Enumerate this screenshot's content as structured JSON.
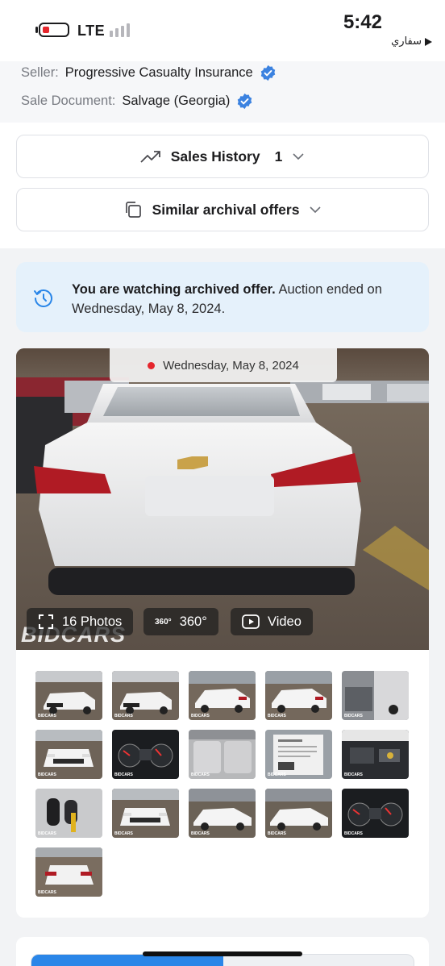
{
  "status_bar": {
    "carrier": "LTE",
    "time": "5:42",
    "back_app": "سفاري",
    "back_icon": "play-arrow-icon"
  },
  "seller": {
    "seller_label": "Seller:",
    "seller_value": "Progressive Casualty Insurance",
    "doc_label": "Sale Document:",
    "doc_value": "Salvage (Georgia)"
  },
  "accordions": {
    "sales_history": {
      "label": "Sales History",
      "count": "1",
      "icon": "trending-up-icon"
    },
    "similar": {
      "label": "Similar archival offers",
      "icon": "copy-icon"
    }
  },
  "notice": {
    "bold": "You are watching archived offer.",
    "text": " Auction ended on Wednesday, May 8, 2024."
  },
  "gallery": {
    "date": "Wednesday, May 8, 2024",
    "photos_label": "16 Photos",
    "pano_badge": "360°",
    "pano_label": "360°",
    "video_label": "Video",
    "watermark": "BIDCARS",
    "thumb_watermark": "BIDCARS",
    "thumbnails": [
      "front-three-quarter",
      "front-three-quarter",
      "side-rear",
      "side-rear",
      "interior-door",
      "front",
      "gauge-cluster",
      "rear-seats",
      "window-sticker",
      "engine-bay",
      "key-fobs",
      "front",
      "side",
      "side",
      "gauge-cluster",
      "rear"
    ]
  },
  "colors": {
    "accent": "#2a86e8",
    "verified": "#3b82e0",
    "notice_bg": "#e5f1fb",
    "record_dot": "#e5262d"
  }
}
